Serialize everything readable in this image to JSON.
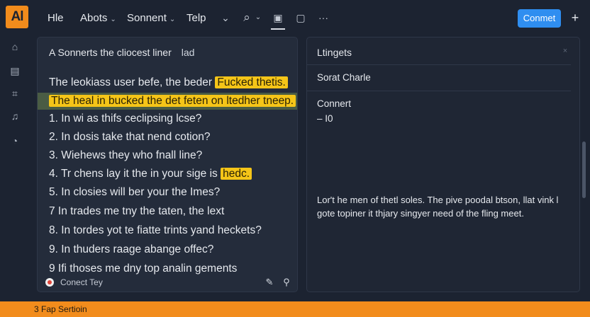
{
  "app": {
    "logo_text": "Al",
    "accent": "#f28c1c",
    "primary": "#2f8ef0",
    "highlight": "#f5c518"
  },
  "menu": [
    {
      "label": "Hle",
      "has_caret": false
    },
    {
      "label": "Abots",
      "has_caret": true
    },
    {
      "label": "Sonnent",
      "has_caret": true
    },
    {
      "label": "Telp",
      "has_caret": false
    }
  ],
  "toolbar": {
    "caret": "⌄",
    "search_icon": "⌕",
    "search_caret": "⌄",
    "clipboard_icon": "▣",
    "image_icon": "▢",
    "more_icon": "···",
    "connect_label": "Conmet",
    "plus_label": "+"
  },
  "rail": [
    {
      "icon": "home-icon",
      "glyph": "⌂"
    },
    {
      "icon": "stack-icon",
      "glyph": "▤"
    },
    {
      "icon": "scan-icon",
      "glyph": "⌗"
    },
    {
      "icon": "music-icon",
      "glyph": "♫"
    },
    {
      "icon": "compass-icon",
      "glyph": "◔"
    }
  ],
  "editor": {
    "title": "A Sonnerts the cliocest liner",
    "title_tag": "lad",
    "line1_text": "The leokiass user befe, the beder ",
    "line1_hl": "Fucked thetis.",
    "line2_hl": "The heal in bucked the det feten on ltedher tneep.",
    "line3": "1. In wi as thifs ceclipsing lcse?",
    "line4": "2. In dosis take that nend cotion?",
    "line5": "3. Wiehews they who fnall line?",
    "line6_text": "4. Tr chens lay it the in your sige is ",
    "line6_hl": "hedc.",
    "line7": "5. In closies will ber your the Imes?",
    "line8": "7  In trades me tny the taten, the lext",
    "line9": "8. In tordes yot te fiatte trints yand heckets?",
    "line10": "9. In thuders raage abange offec?",
    "line11": "9  Ifi thoses me dny top analin gements",
    "footer_text": "Conect Tey",
    "edit_icon": "✎",
    "tool_icon": "⚲"
  },
  "details": {
    "title": "Ltingets",
    "close_icon": "×",
    "subtitle": "Sorat Charle",
    "label": "Connert",
    "value": "– I0",
    "description": "Lor't he men of thetl soles. The pive poodal btson, llat vink l gote topiner it thjary singyer need of the fling meet."
  },
  "status": {
    "text": "3 Fap Sertioin"
  }
}
